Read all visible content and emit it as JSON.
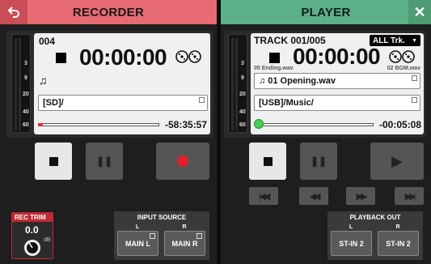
{
  "header": {
    "recorder_title": "RECORDER",
    "player_title": "PLAYER",
    "back_icon": "back-arrow-icon",
    "close_icon": "close-icon",
    "close_glyph": "✕"
  },
  "colors": {
    "recorder": "#e86a72",
    "player": "#5cb088"
  },
  "recorder": {
    "meter_scale": [
      "3",
      "9",
      "20",
      "40",
      "60"
    ],
    "file_number": "004",
    "time": "00:00:00",
    "path": "[SD]/",
    "remaining": "-58:35:57",
    "position_fraction": 0.0,
    "buttons": {
      "stop": "■",
      "pause": "❚❚",
      "record": "●"
    },
    "rec_trim": {
      "label": "REC TRIM",
      "value": "0.0",
      "unit": "dB"
    },
    "input_source": {
      "label": "INPUT SOURCE",
      "left_channel": "L",
      "right_channel": "R",
      "left_button": "MAIN L",
      "right_button": "MAIN R"
    }
  },
  "player": {
    "meter_scale": [
      "3",
      "9",
      "20",
      "40",
      "60"
    ],
    "track": "TRACK 001/005",
    "mode": "ALL Trk.",
    "prev_file": "05 Ending.wav",
    "next_file": "02 BGM.wav",
    "time": "00:00:00",
    "current_file": "01 Opening.wav",
    "path": "[USB]/Music/",
    "remaining": "-00:05:08",
    "position_fraction": 0.0,
    "buttons": {
      "stop": "■",
      "pause": "❚❚",
      "play": "▶",
      "prev": "|◀◀",
      "rew": "◀◀",
      "ffwd": "▶▶",
      "next": "▶▶|"
    },
    "playback_out": {
      "label": "PLAYBACK OUT",
      "left_channel": "L",
      "right_channel": "R",
      "left_button": "ST-IN 2",
      "right_button": "ST-IN 2"
    }
  }
}
